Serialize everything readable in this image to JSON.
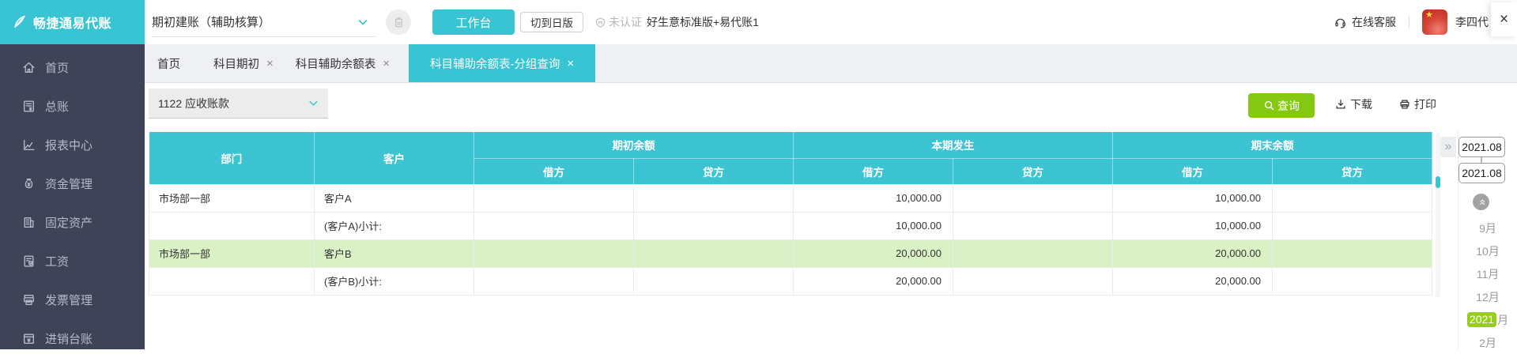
{
  "brand": {
    "name": "畅捷通易代账"
  },
  "topbar": {
    "account_select": "期初建账（辅助核算）",
    "workbench_btn": "工作台",
    "switch_old_btn": "切到日版",
    "cert_status": "未认证",
    "product_name": "好生意标准版+易代账1",
    "online_support": "在线客服",
    "username": "李四代"
  },
  "sidebar": {
    "items": [
      {
        "id": "home",
        "label": "首页",
        "icon": "home-icon"
      },
      {
        "id": "general-ledger",
        "label": "总账",
        "icon": "ledger-icon"
      },
      {
        "id": "report-center",
        "label": "报表中心",
        "icon": "chart-icon"
      },
      {
        "id": "funds",
        "label": "资金管理",
        "icon": "moneybag-icon"
      },
      {
        "id": "fixed-assets",
        "label": "固定资产",
        "icon": "building-icon"
      },
      {
        "id": "payroll",
        "label": "工资",
        "icon": "payroll-icon"
      },
      {
        "id": "invoice",
        "label": "发票管理",
        "icon": "invoice-icon"
      },
      {
        "id": "purchase-sales",
        "label": "进销台账",
        "icon": "inout-ledger-icon"
      }
    ]
  },
  "tabs": {
    "items": [
      {
        "id": "home",
        "label": "首页",
        "closable": false,
        "active": false
      },
      {
        "id": "subject-initial",
        "label": "科目期初",
        "closable": true,
        "active": false
      },
      {
        "id": "subject-aux-balance",
        "label": "科目辅助余额表",
        "closable": true,
        "active": false
      },
      {
        "id": "subject-aux-balance-group",
        "label": "科目辅助余额表-分组查询",
        "closable": true,
        "active": true
      }
    ]
  },
  "toolbar": {
    "subject_select": "1122 应收账款",
    "query_btn": "查询",
    "download_btn": "下载",
    "print_btn": "打印"
  },
  "table": {
    "fixed_columns": [
      "部门",
      "客户"
    ],
    "column_groups": [
      "期初余额",
      "本期发生",
      "期末余额"
    ],
    "sub_columns": [
      "借方",
      "贷方"
    ],
    "rows": [
      {
        "dept": "市场部一部",
        "customer": "客户A",
        "initial_debit": "",
        "initial_credit": "",
        "period_debit": "10,000.00",
        "period_credit": "",
        "ending_debit": "10,000.00",
        "ending_credit": "",
        "highlight": false
      },
      {
        "dept": "",
        "customer": "(客户A)小计:",
        "initial_debit": "",
        "initial_credit": "",
        "period_debit": "10,000.00",
        "period_credit": "",
        "ending_debit": "10,000.00",
        "ending_credit": "",
        "highlight": false
      },
      {
        "dept": "市场部一部",
        "customer": "客户B",
        "initial_debit": "",
        "initial_credit": "",
        "period_debit": "20,000.00",
        "period_credit": "",
        "ending_debit": "20,000.00",
        "ending_credit": "",
        "highlight": true
      },
      {
        "dept": "",
        "customer": "(客户B)小计:",
        "initial_debit": "",
        "initial_credit": "",
        "period_debit": "20,000.00",
        "period_credit": "",
        "ending_debit": "20,000.00",
        "ending_credit": "",
        "highlight": false
      }
    ]
  },
  "period": {
    "date_from": "2021.08",
    "date_to": "2021.08",
    "months": [
      {
        "label": "9月"
      },
      {
        "label": "10月"
      },
      {
        "label": "11月"
      },
      {
        "label": "12月"
      },
      {
        "label": "月",
        "year_badge": "2021"
      },
      {
        "label": "2月"
      }
    ]
  },
  "colors": {
    "accent_cyan": "#38c4d2",
    "sidebar_bg": "#3e4357",
    "query_green": "#85c812",
    "year_badge_green": "#97cf14",
    "highlight_row": "#d9f1c4"
  }
}
